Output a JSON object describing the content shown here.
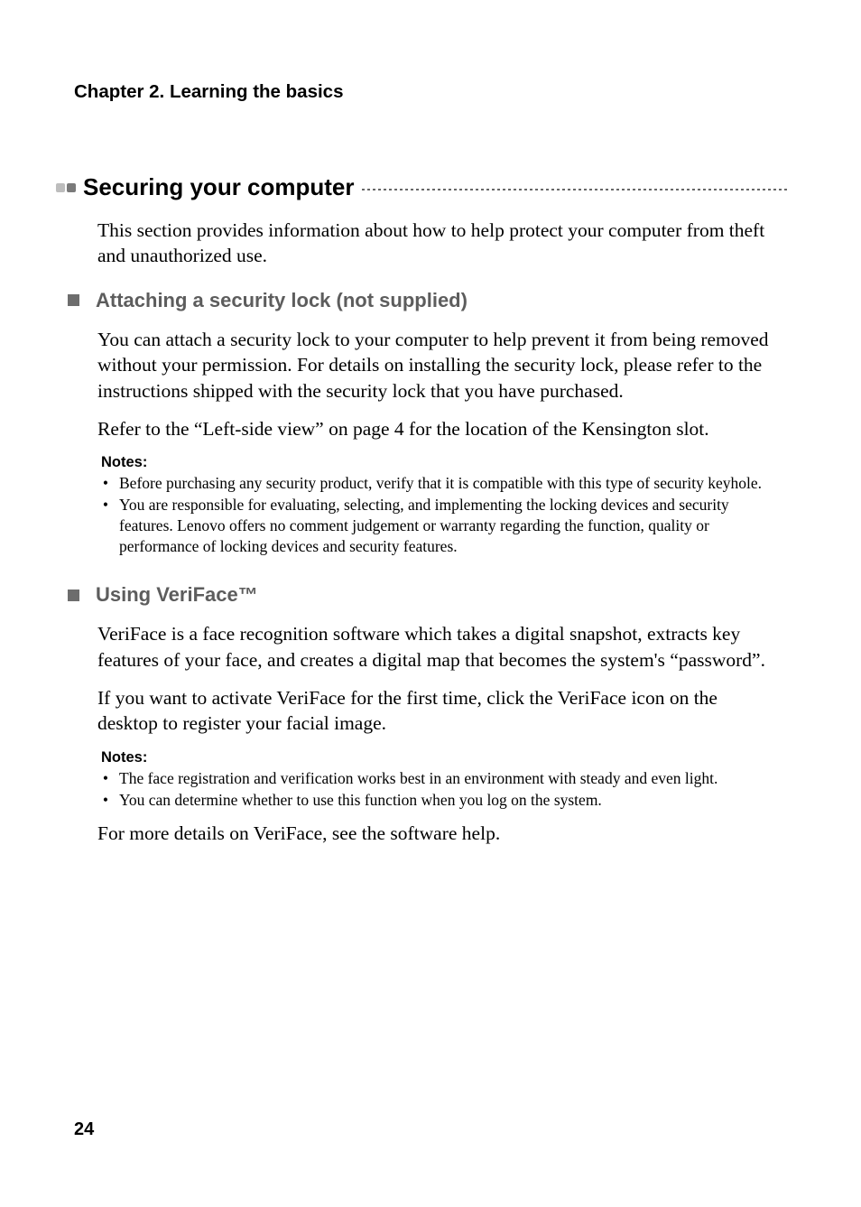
{
  "chapter": "Chapter 2. Learning the basics",
  "h1": "Securing your computer",
  "intro": "This section provides information about how to help protect your computer from theft and unauthorized use.",
  "sec1": {
    "title": "Attaching a security lock (not supplied)",
    "p1": "You can attach a security lock to your computer to help prevent it from being removed without your permission. For details on installing the security lock, please refer to the instructions shipped with the security lock that you have purchased.",
    "p2": "Refer to the “Left-side view” on page 4 for the location of the Kensington slot.",
    "notes_label": "Notes:",
    "notes": [
      "Before purchasing any security product, verify that it is compatible with this type of security keyhole.",
      "You are responsible for evaluating, selecting, and implementing the locking devices and security features. Lenovo offers no comment judgement or warranty regarding the function, quality or performance of locking devices and security features."
    ]
  },
  "sec2": {
    "title": "Using VeriFace™",
    "p1": "VeriFace is a face recognition software which takes a digital snapshot, extracts key features of your face, and creates a digital map that becomes the system's “password”.",
    "p2": "If you want to activate VeriFace for the first time, click the VeriFace icon on the desktop to register your facial image.",
    "notes_label": "Notes:",
    "notes": [
      "The face registration and verification works best in an environment with steady and even light.",
      "You can determine whether to use this function when you log on the system."
    ],
    "p3": "For more details on VeriFace, see the software help."
  },
  "page_number": "24"
}
